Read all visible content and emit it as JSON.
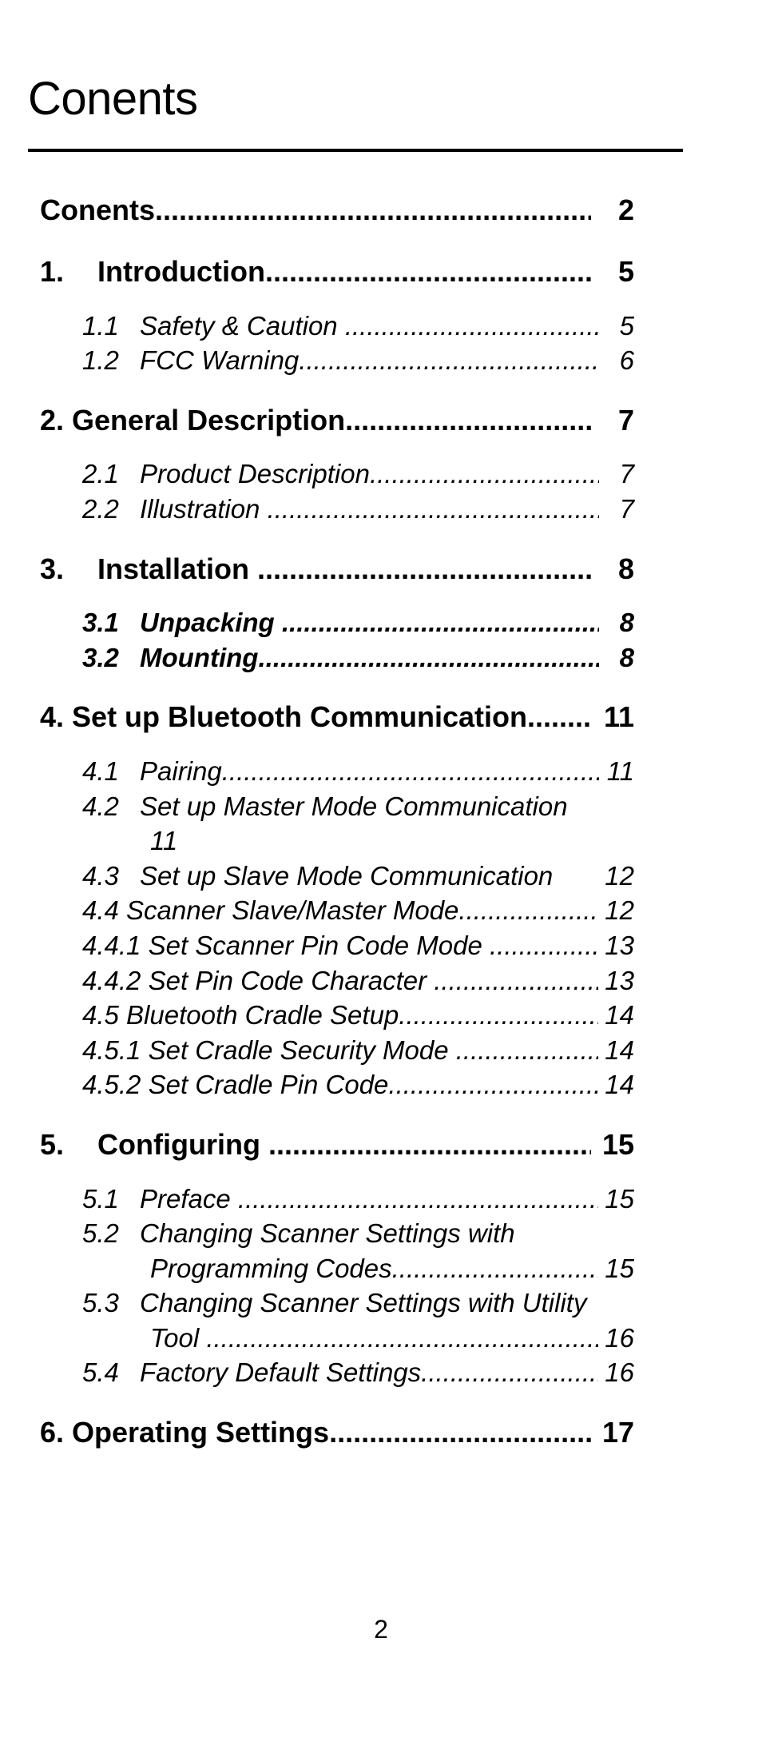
{
  "document": {
    "title": "Conents",
    "footer_page_number": "2"
  },
  "toc": {
    "entries": [
      {
        "level": 1,
        "number": "",
        "label": "Conents",
        "leader": true,
        "page": "2",
        "bold": true,
        "italic": false
      },
      {
        "level": 1,
        "number": "1.",
        "label": "Introduction",
        "leader": true,
        "page": "5",
        "bold": true,
        "italic": false
      },
      {
        "level": 2,
        "number": "1.1",
        "label": "Safety & Caution ",
        "leader": true,
        "page": "5",
        "bold": false,
        "italic": true
      },
      {
        "level": 2,
        "number": "1.2",
        "label": "FCC Warning",
        "leader": true,
        "page": "6",
        "bold": false,
        "italic": true
      },
      {
        "level": 1,
        "number": "2.",
        "label": "General Description",
        "leader": true,
        "page": "7",
        "bold": true,
        "italic": false
      },
      {
        "level": 2,
        "number": "2.1",
        "label": "Product Description",
        "leader": true,
        "page": "7",
        "bold": false,
        "italic": true
      },
      {
        "level": 2,
        "number": "2.2",
        "label": "Illustration ",
        "leader": true,
        "page": "7",
        "bold": false,
        "italic": true
      },
      {
        "level": 1,
        "number": "3.",
        "label": "Installation ",
        "leader": true,
        "page": "8",
        "bold": true,
        "italic": false
      },
      {
        "level": 2,
        "number": "3.1",
        "label": "Unpacking ",
        "leader": true,
        "page": "8",
        "bold": true,
        "italic": true
      },
      {
        "level": 2,
        "number": "3.2",
        "label": "Mounting",
        "leader": true,
        "page": "8",
        "bold": true,
        "italic": true
      },
      {
        "level": 1,
        "number": "4.",
        "label": "Set up Bluetooth Communication",
        "leader": true,
        "page": "11",
        "bold": true,
        "italic": false
      },
      {
        "level": 2,
        "number": "4.1",
        "label": "Pairing",
        "leader": true,
        "page": "11",
        "bold": false,
        "italic": true
      },
      {
        "level": 2,
        "number": "4.2",
        "label": "Set up Master Mode Communication",
        "leader": false,
        "page": "11",
        "wrapped": true,
        "continuation": "",
        "bold": false,
        "italic": true
      },
      {
        "level": 2,
        "number": "4.3",
        "label": "Set up Slave Mode Communication",
        "leader": false,
        "page": "12",
        "bold": false,
        "italic": true
      },
      {
        "level": 2,
        "number": "4.4",
        "label": "Scanner Slave/Master Mode",
        "leader": true,
        "page": "12",
        "bold": false,
        "italic": true
      },
      {
        "level": 2,
        "number": "4.4.1",
        "label": "Set Scanner Pin Code Mode ",
        "leader": true,
        "page": "13",
        "bold": false,
        "italic": true
      },
      {
        "level": 2,
        "number": "4.4.2",
        "label": "Set Pin Code Character ",
        "leader": true,
        "page": "13",
        "bold": false,
        "italic": true
      },
      {
        "level": 2,
        "number": "4.5",
        "label": "Bluetooth Cradle Setup",
        "leader": true,
        "page": "14",
        "bold": false,
        "italic": true
      },
      {
        "level": 2,
        "number": "4.5.1",
        "label": "Set Cradle Security Mode ",
        "leader": true,
        "page": "14",
        "bold": false,
        "italic": true
      },
      {
        "level": 2,
        "number": "4.5.2",
        "label": "Set Cradle Pin Code",
        "leader": true,
        "page": "14",
        "bold": false,
        "italic": true
      },
      {
        "level": 1,
        "number": "5.",
        "label": "Configuring ",
        "leader": true,
        "page": "15",
        "bold": true,
        "italic": false
      },
      {
        "level": 2,
        "number": "5.1",
        "label": "Preface ",
        "leader": true,
        "page": "15",
        "bold": false,
        "italic": true
      },
      {
        "level": 2,
        "number": "5.2",
        "label": "Changing Scanner Settings with",
        "leader": false,
        "page": "15",
        "wrapped": true,
        "continuation": "Programming Codes",
        "bold": false,
        "italic": true
      },
      {
        "level": 2,
        "number": "5.3",
        "label": "Changing Scanner Settings with Utility",
        "leader": false,
        "page": "16",
        "wrapped": true,
        "continuation": "Tool ",
        "bold": false,
        "italic": true
      },
      {
        "level": 2,
        "number": "5.4",
        "label": "Factory Default Settings",
        "leader": true,
        "page": "16",
        "bold": false,
        "italic": true
      },
      {
        "level": 1,
        "number": "6.",
        "label": "Operating Settings",
        "leader": true,
        "page": "17",
        "bold": true,
        "italic": false
      }
    ],
    "numbering_labels": {
      "e0": "",
      "e1": "1.",
      "e2": "1.1",
      "e3": "1.2",
      "e4": "2.",
      "e5": "2.1",
      "e6": "2.2",
      "e7": "3.",
      "e8": "3.1",
      "e9": "3.2",
      "e10": "4.",
      "e11": "4.1",
      "e12": "4.2",
      "e13": "4.3",
      "e14": "4.4",
      "e15": "4.4.1",
      "e16": "4.4.2",
      "e17": "4.5",
      "e18": "4.5.1",
      "e19": "4.5.2",
      "e20": "5.",
      "e21": "5.1",
      "e22": "5.2",
      "e23": "5.3",
      "e24": "5.4",
      "e25": "6."
    }
  }
}
